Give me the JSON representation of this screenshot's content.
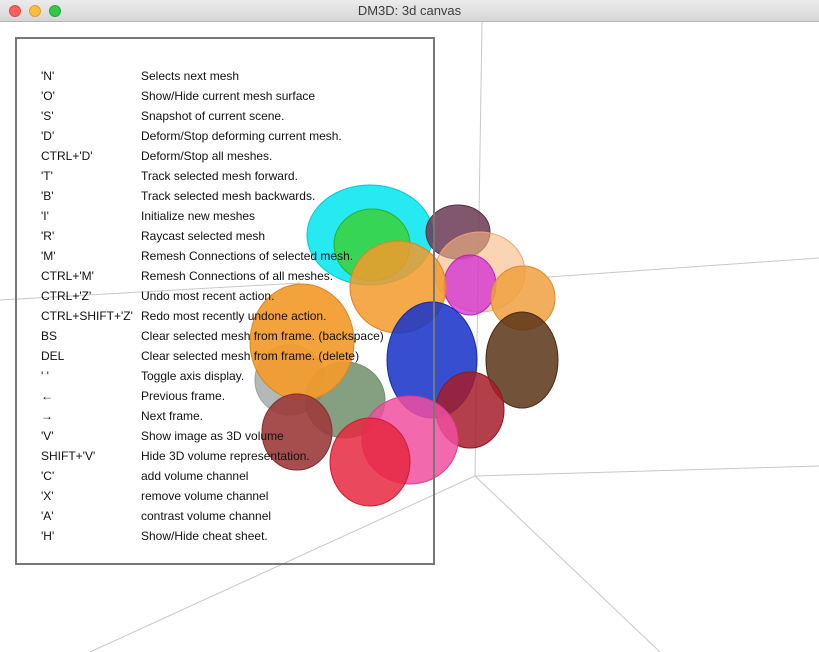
{
  "window": {
    "title": "DM3D: 3d canvas"
  },
  "cheatsheet": [
    {
      "key": "'N'",
      "desc": "Selects next mesh"
    },
    {
      "key": "'O'",
      "desc": "Show/Hide current mesh surface"
    },
    {
      "key": "'S'",
      "desc": "Snapshot of current scene."
    },
    {
      "key": "'D'",
      "desc": "Deform/Stop deforming current mesh."
    },
    {
      "key": "CTRL+'D'",
      "desc": "Deform/Stop all meshes."
    },
    {
      "key": "'T'",
      "desc": "Track selected mesh forward."
    },
    {
      "key": "'B'",
      "desc": "Track selected mesh backwards."
    },
    {
      "key": "'I'",
      "desc": "Initialize new meshes"
    },
    {
      "key": "'R'",
      "desc": "Raycast selected mesh"
    },
    {
      "key": "'M'",
      "desc": "Remesh Connections of selected mesh."
    },
    {
      "key": "CTRL+'M'",
      "desc": "Remesh Connections of all meshes."
    },
    {
      "key": "CTRL+'Z'",
      "desc": "Undo most recent action."
    },
    {
      "key": "CTRL+SHIFT+'Z'",
      "desc": "Redo most recently undone action."
    },
    {
      "key": "BS",
      "desc": "Clear selected mesh from frame. (backspace)"
    },
    {
      "key": "DEL",
      "desc": "Clear selected mesh from frame. (delete)"
    },
    {
      "key": "' '",
      "desc": "Toggle axis display."
    },
    {
      "key": "←",
      "desc": "Previous frame."
    },
    {
      "key": "→",
      "desc": "Next frame."
    },
    {
      "key": "'V'",
      "desc": "Show image as 3D volume"
    },
    {
      "key": "SHIFT+'V'",
      "desc": "Hide 3D volume representation."
    },
    {
      "key": "'C'",
      "desc": "add volume channel"
    },
    {
      "key": "'X'",
      "desc": "remove volume channel"
    },
    {
      "key": "'A'",
      "desc": "contrast volume channel"
    },
    {
      "key": "'H'",
      "desc": "Show/Hide cheat sheet."
    }
  ],
  "meshes": [
    {
      "name": "cyan",
      "color": "#00e5ee"
    },
    {
      "name": "green",
      "color": "#3ccf2e"
    },
    {
      "name": "orange",
      "color": "#f39a2b"
    },
    {
      "name": "peach",
      "color": "#f6b781"
    },
    {
      "name": "plum",
      "color": "#6b3a55"
    },
    {
      "name": "magenta",
      "color": "#d02bd6"
    },
    {
      "name": "light-orange",
      "color": "#f0a040"
    },
    {
      "name": "blue",
      "color": "#1b36c9"
    },
    {
      "name": "brown",
      "color": "#5a3418"
    },
    {
      "name": "dark-red",
      "color": "#a61d2a"
    },
    {
      "name": "pink",
      "color": "#f04fa0"
    },
    {
      "name": "red",
      "color": "#e6283f"
    },
    {
      "name": "rose-brown",
      "color": "#9c3b3b"
    },
    {
      "name": "sage",
      "color": "#6f8f6a"
    },
    {
      "name": "grey",
      "color": "#9aa0a0"
    }
  ]
}
